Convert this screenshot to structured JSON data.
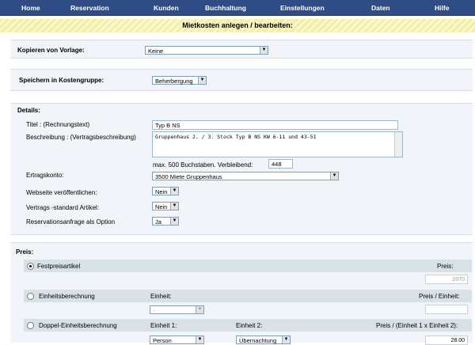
{
  "nav": [
    "Home",
    "Reservation",
    "Kunden",
    "Buchhaltung",
    "Einstellungen",
    "Daten",
    "Hilfe"
  ],
  "page_title": "Mietkosten anlegen / bearbeiten:",
  "kopieren": {
    "label": "Kopieren von Vorlage:",
    "value": "Keine"
  },
  "speichern": {
    "label": "Speichern in Kostengruppe:",
    "value": "Beherbergung"
  },
  "details": {
    "label": "Details:",
    "titel_label": "Titel : (Rechnungstext)",
    "titel_value": "Typ B NS",
    "beschreibung_label": "Beschreibung : (Vertragsbeschreibung)",
    "beschreibung_value": "Gruppenhaus 2. / 3. Stock Typ B NS KW 6-11 und 43-51",
    "max_text": "max. 500 Buchstaben. Verbleibend:",
    "remaining": "448",
    "ertrag_label": "Ertragskonto:",
    "ertrag_value": "3500 Miete Gruppenhaus",
    "web_label": "Webseite veröffentlichen:",
    "web_value": "Nein",
    "std_label": "Vertrags -standard Artikel:",
    "std_value": "Nein",
    "opt_label": "Reservationsanfrage als Option",
    "opt_value": "Ja"
  },
  "preis": {
    "label": "Preis:",
    "fest_label": "Festpreisartikel",
    "fest_preis_label": "Preis:",
    "fest_preis_value": "2070",
    "einheit_label": "Einheitsberechnung",
    "einheit_col": "Einheit:",
    "einheit_preis_label": "Preis / Einheit:",
    "einheit_select": "-",
    "doppel_label": "Doppel-Einheitsberechnung",
    "doppel_col1": "Einheit 1:",
    "doppel_col2": "Einheit 2:",
    "doppel_preis_label": "Preis / (Einheit 1 x Einheit 2):",
    "doppel_sel1": "Person",
    "doppel_sel2": "Übernachtung",
    "doppel_value": "28.00"
  }
}
